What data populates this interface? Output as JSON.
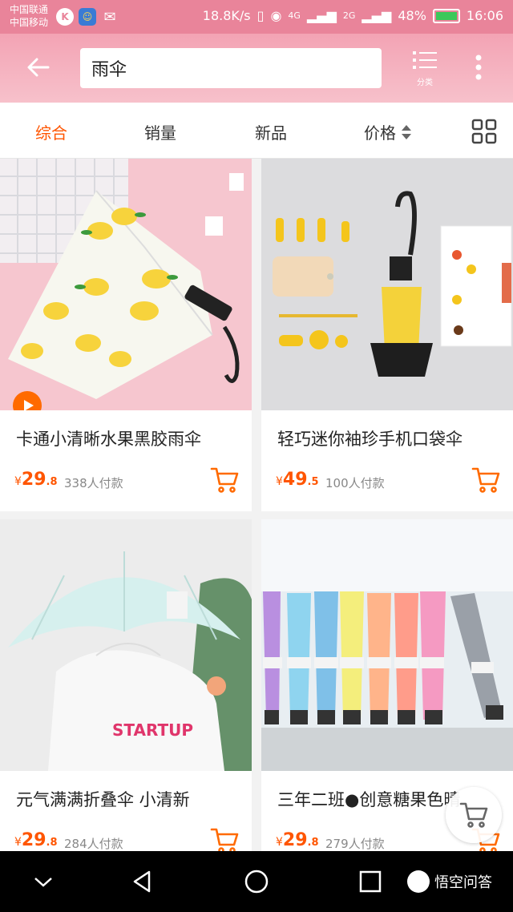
{
  "status_bar": {
    "carrier1": "中国联通",
    "carrier2": "中国移动",
    "speed": "18.8K/s",
    "signal1": "4G",
    "signal2": "2G",
    "battery": "48%",
    "time": "16:06"
  },
  "header": {
    "search_value": "雨伞",
    "category_label": "分类"
  },
  "sort_tabs": [
    {
      "label": "综合",
      "active": true
    },
    {
      "label": "销量",
      "active": false
    },
    {
      "label": "新品",
      "active": false
    },
    {
      "label": "价格",
      "active": false
    }
  ],
  "products": [
    {
      "title": "卡通小清晰水果黑胶雨伞",
      "price_int": "29",
      "price_dec": ".8",
      "sold": "338人付款"
    },
    {
      "title": "轻巧迷你袖珍手机口袋伞",
      "price_int": "49",
      "price_dec": ".5",
      "sold": "100人付款"
    },
    {
      "title": "元气满满折叠伞 小清新",
      "price_int": "29",
      "price_dec": ".8",
      "sold": "284人付款"
    },
    {
      "title": "三年二班●创意糖果色晴",
      "price_int": "29",
      "price_dec": ".8",
      "sold": "279人付款"
    }
  ],
  "currency": "¥",
  "watermark": "悟空问答",
  "colors": {
    "accent": "#ff5500",
    "header": "#f3a3b4",
    "statusbar": "#e9849a"
  }
}
